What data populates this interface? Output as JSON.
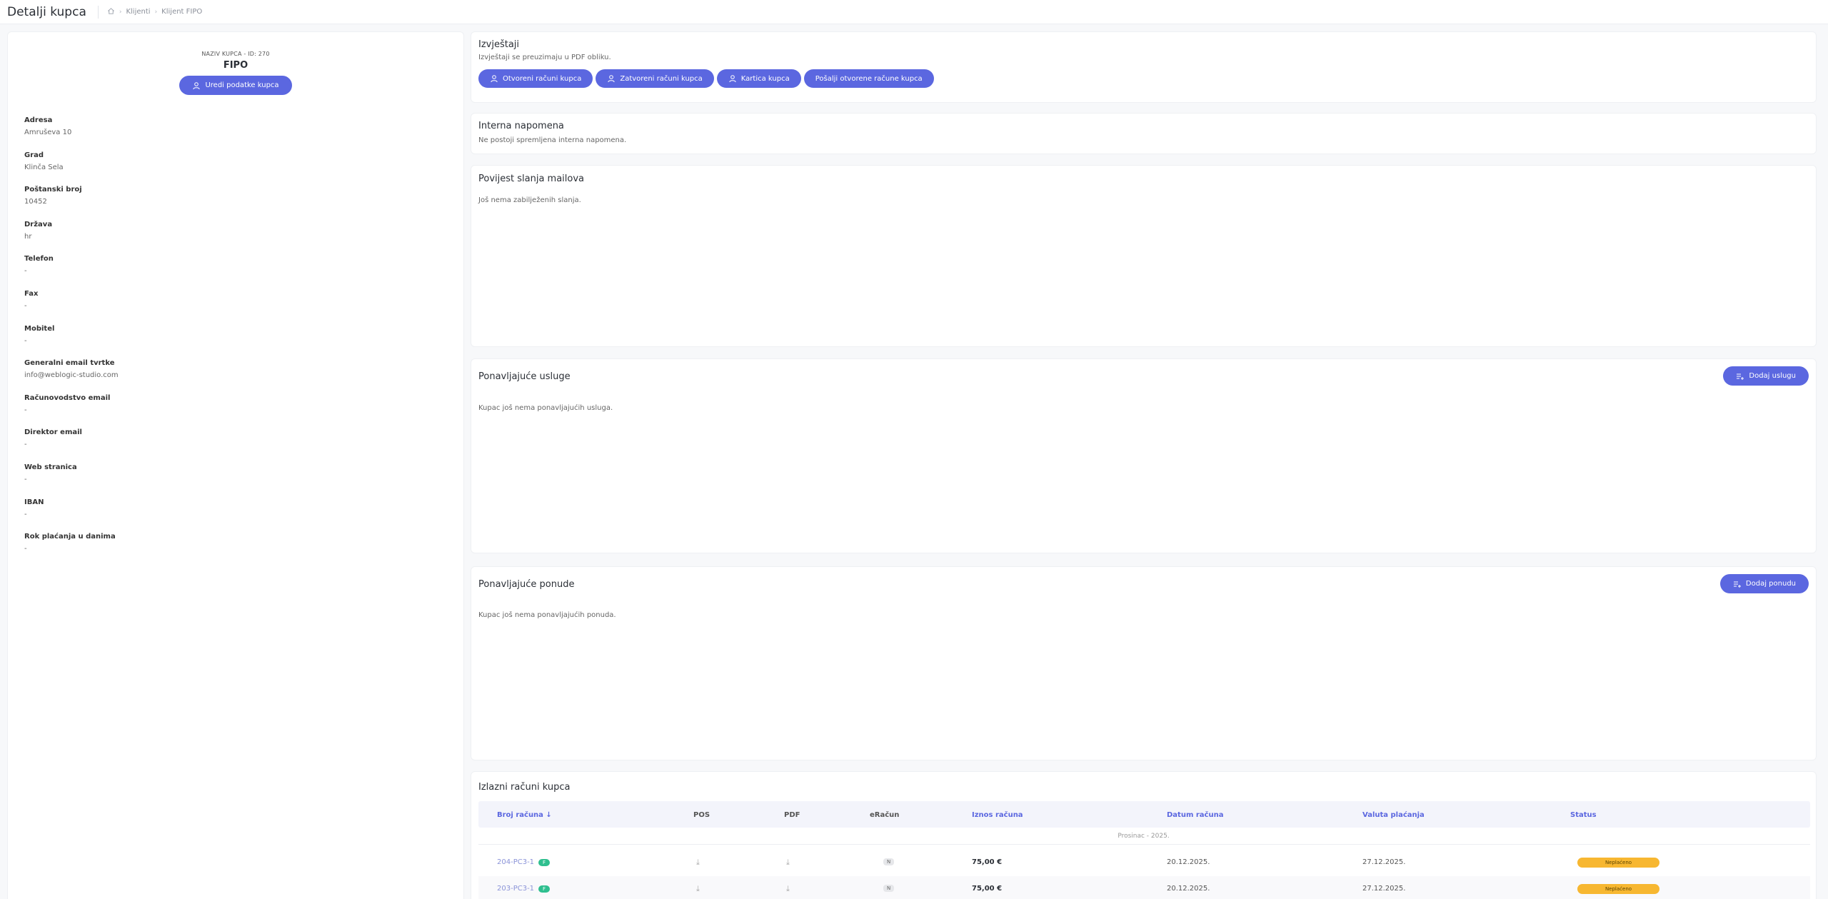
{
  "header": {
    "title": "Detalji kupca",
    "breadcrumb": [
      "Klijenti",
      "Klijent FIPO"
    ]
  },
  "client": {
    "subtitle": "NAZIV KUPCA - ID: 270",
    "name": "FIPO",
    "edit_label": "Uredi podatke kupca",
    "fields": [
      {
        "label": "Adresa",
        "value": "Amruševa 10"
      },
      {
        "label": "Grad",
        "value": "Klinča Sela"
      },
      {
        "label": "Poštanski broj",
        "value": "10452"
      },
      {
        "label": "Država",
        "value": "hr"
      },
      {
        "label": "Telefon",
        "value": "-"
      },
      {
        "label": "Fax",
        "value": "-"
      },
      {
        "label": "Mobitel",
        "value": "-"
      },
      {
        "label": "Generalni email tvrtke",
        "value": "info@weblogic-studio.com"
      },
      {
        "label": "Računovodstvo email",
        "value": "-"
      },
      {
        "label": "Direktor email",
        "value": "-"
      },
      {
        "label": "Web stranica",
        "value": "-"
      },
      {
        "label": "IBAN",
        "value": "-"
      },
      {
        "label": "Rok plaćanja u danima",
        "value": "-"
      }
    ]
  },
  "reports": {
    "title": "Izvještaji",
    "subtitle": "Izvještaji se preuzimaju u PDF obliku.",
    "buttons": [
      "Otvoreni računi kupca",
      "Zatvoreni računi kupca",
      "Kartica kupca",
      "Pošalji otvorene račune kupca"
    ]
  },
  "note": {
    "title": "Interna napomena",
    "text": "Ne postoji spremljena interna napomena."
  },
  "mail_history": {
    "title": "Povijest slanja mailova",
    "text": "Još nema zabilježenih slanja."
  },
  "services": {
    "title": "Ponavljajuće usluge",
    "text": "Kupac još nema ponavljajućih usluga.",
    "button": "Dodaj uslugu"
  },
  "offers": {
    "title": "Ponavljajuće ponude",
    "text": "Kupac još nema ponavljajućih ponuda.",
    "button": "Dodaj ponudu"
  },
  "invoices": {
    "title": "Izlazni računi kupca",
    "columns": [
      "Broj računa",
      "POS",
      "PDF",
      "eRačun",
      "Iznos računa",
      "Datum računa",
      "Valuta plaćanja",
      "Status"
    ],
    "group": "Prosinac - 2025.",
    "rows": [
      {
        "number": "204-PC3-1",
        "badge": "F",
        "erac": "N",
        "amount": "75,00 €",
        "date": "20.12.2025.",
        "due": "27.12.2025.",
        "status": "Neplaćeno"
      },
      {
        "number": "203-PC3-1",
        "badge": "F",
        "erac": "N",
        "amount": "75,00 €",
        "date": "20.12.2025.",
        "due": "27.12.2025.",
        "status": "Neplaćeno"
      }
    ]
  },
  "colors": {
    "accent": "#5b67e0",
    "status_unpaid": "#f7b731",
    "badge_f": "#2fbf8f"
  },
  "icons": {
    "home": "home-icon",
    "user": "user-icon",
    "list": "list-add-icon",
    "sort": "arrow-down-icon",
    "download": "download-icon"
  }
}
